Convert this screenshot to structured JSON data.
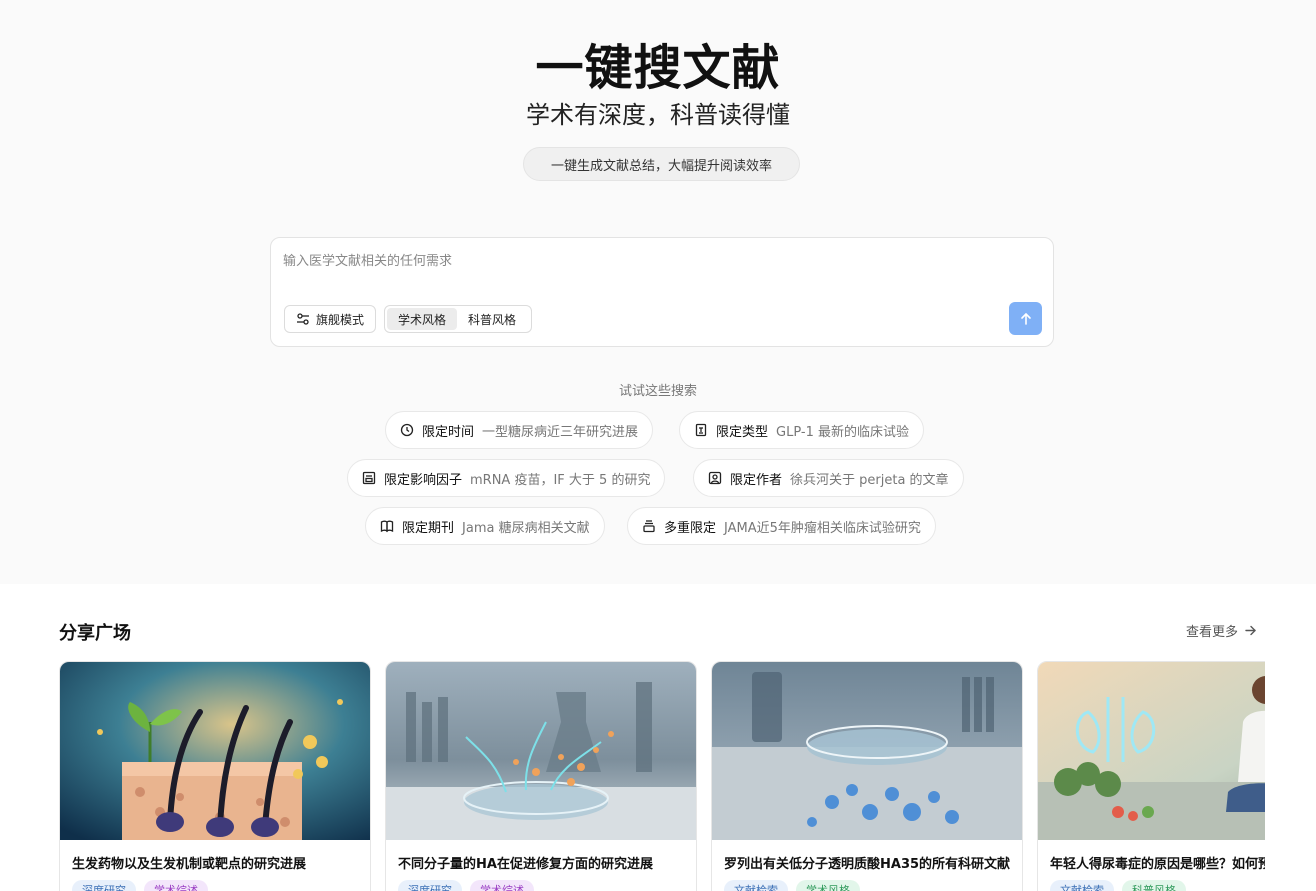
{
  "hero": {
    "title": "一键搜文献",
    "subtitle": "学术有深度，科普读得懂",
    "tagline": "一键生成文献总结，大幅提升阅读效率"
  },
  "search": {
    "placeholder": "输入医学文献相关的任何需求",
    "value": "",
    "mode_label": "旗舰模式",
    "styles": [
      {
        "label": "学术风格",
        "active": true
      },
      {
        "label": "科普风格",
        "active": false
      }
    ],
    "send_icon": "arrow-up-icon"
  },
  "suggestions": {
    "label": "试试这些搜索",
    "chips": [
      {
        "icon": "clock-icon",
        "label": "限定时间",
        "example": "一型糖尿病近三年研究进展"
      },
      {
        "icon": "document-type-icon",
        "label": "限定类型",
        "example": "GLP-1 最新的临床试验"
      },
      {
        "icon": "impact-factor-icon",
        "label": "限定影响因子",
        "example": "mRNA 疫苗，IF 大于 5 的研究"
      },
      {
        "icon": "author-icon",
        "label": "限定作者",
        "example": "徐兵河关于 perjeta 的文章"
      },
      {
        "icon": "book-icon",
        "label": "限定期刊",
        "example": "Jama 糖尿病相关文献"
      },
      {
        "icon": "layers-icon",
        "label": "多重限定",
        "example": "JAMA近5年肿瘤相关临床试验研究"
      }
    ]
  },
  "share": {
    "title": "分享广场",
    "more_label": "查看更多",
    "cards": [
      {
        "title": "生发药物以及生发机制或靶点的研究进展",
        "tags": [
          "深度研究",
          "学术综述"
        ]
      },
      {
        "title": "不同分子量的HA在促进修复方面的研究进展",
        "tags": [
          "深度研究",
          "学术综述"
        ]
      },
      {
        "title": "罗列出有关低分子透明质酸HA35的所有科研文献",
        "tags": [
          "文献检索",
          "学术风格"
        ]
      },
      {
        "title": "年轻人得尿毒症的原因是哪些？如何预防",
        "tags": [
          "文献检索",
          "科普风格"
        ]
      }
    ]
  },
  "colors": {
    "accent": "#7fb0f6",
    "tag_blue_bg": "#e8f0fb",
    "tag_blue_fg": "#3b6fb6",
    "tag_purple_bg": "#f3e6fb",
    "tag_purple_fg": "#9b3fc4",
    "tag_green_bg": "#e2f6ea",
    "tag_green_fg": "#2f9a5b"
  }
}
